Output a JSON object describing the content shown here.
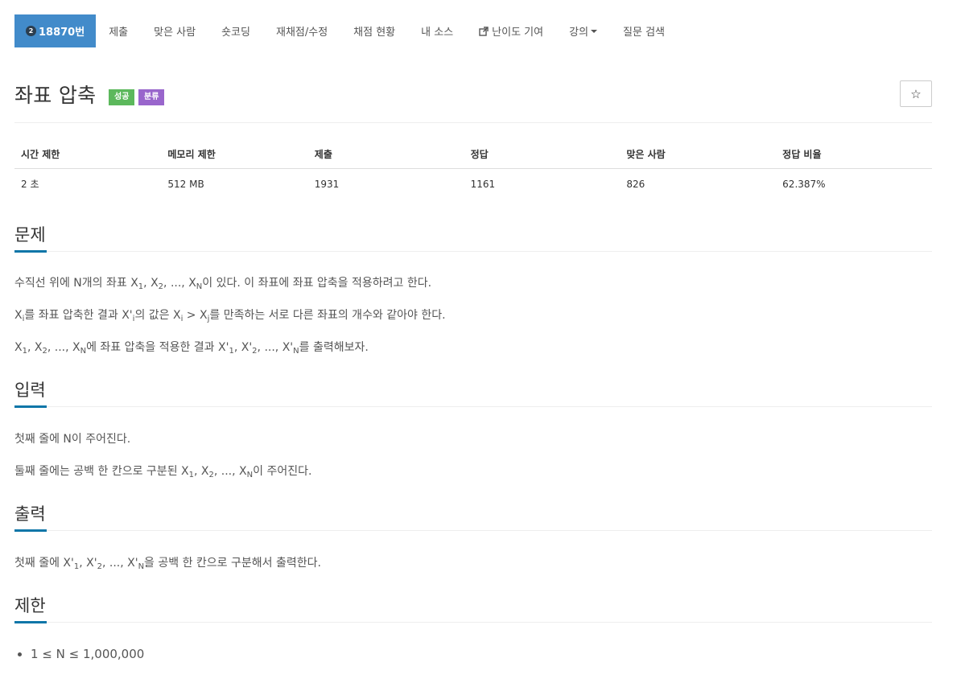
{
  "nav": {
    "problem_id": "18870번",
    "items": [
      "제출",
      "맞은 사람",
      "숏코딩",
      "재채점/수정",
      "채점 현황",
      "내 소스",
      "난이도 기여",
      "강의",
      "질문 검색"
    ]
  },
  "problem": {
    "title": "좌표 압축",
    "label_success": "성공",
    "label_category": "분류",
    "star_label": "☆"
  },
  "stats": {
    "headers": [
      "시간 제한",
      "메모리 제한",
      "제출",
      "정답",
      "맞은 사람",
      "정답 비율"
    ],
    "values": [
      "2 초",
      "512 MB",
      "1931",
      "1161",
      "826",
      "62.387%"
    ]
  },
  "sections": {
    "problem": {
      "title": "문제",
      "p1_a": "수직선 위에 N개의 좌표 X",
      "p1_b": "이 있다. 이 좌표에 좌표 압축을 적용하려고 한다.",
      "p2_a": "를 좌표 압축한 결과 X'",
      "p2_b": "의 값은 X",
      "p2_c": " > X",
      "p2_d": "를 만족하는 서로 다른 좌표의 개수와 같아야 한다.",
      "p3_b": "에 좌표 압축을 적용한 결과 X'",
      "p3_c": "를 출력해보자."
    },
    "input": {
      "title": "입력",
      "p1": "첫째 줄에 N이 주어진다.",
      "p2_a": "둘째 줄에는 공백 한 칸으로 구분된 X",
      "p2_b": "이 주어진다."
    },
    "output": {
      "title": "출력",
      "p1_a": "첫째 줄에 X'",
      "p1_b": "을 공백 한 칸으로 구분해서 출력한다."
    },
    "limits": {
      "title": "제한",
      "item1": "1 ≤ N ≤ 1,000,000"
    }
  }
}
